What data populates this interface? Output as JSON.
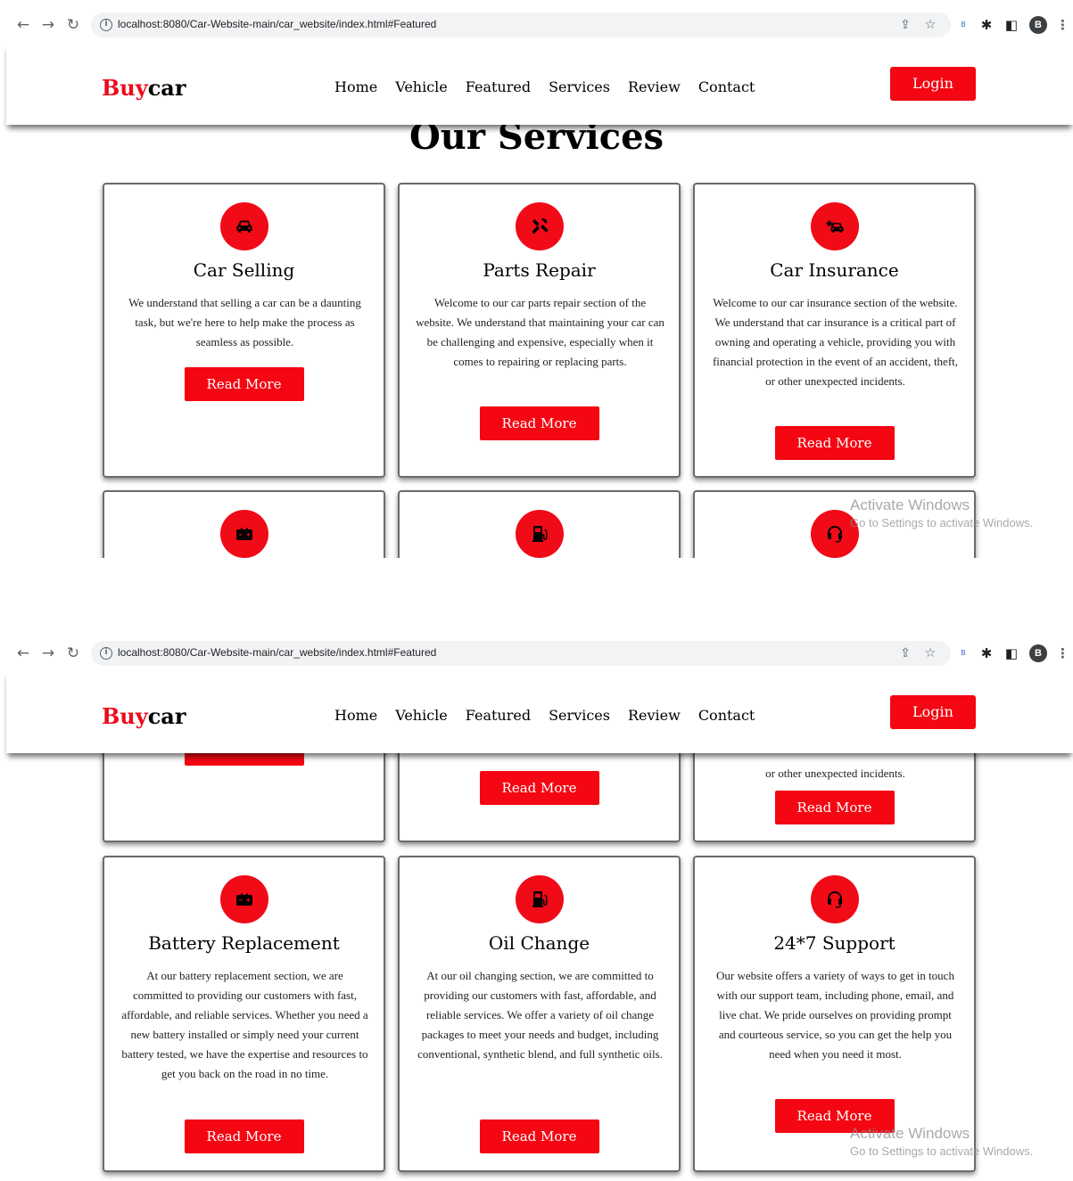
{
  "browser": {
    "url_host": "localhost",
    "url_path": ":8080/Car-Website-main/car_website/index.html#Featured",
    "avatar_letter": "B",
    "profile_badge": "B"
  },
  "header": {
    "logo_red": "Buy",
    "logo_dark": "car",
    "nav": [
      "Home",
      "Vehicle",
      "Featured",
      "Services",
      "Review",
      "Contact"
    ],
    "login_label": "Login"
  },
  "services": {
    "title": "Our Services",
    "cards": [
      {
        "icon": "car-icon",
        "title": "Car Selling",
        "text": "We understand that selling a car can be a daunting task, but we're here to help make the process as seamless as possible.",
        "button": "Read More"
      },
      {
        "icon": "tools-icon",
        "title": "Parts Repair",
        "text": "Welcome to our car parts repair section of the website. We understand that maintaining your car can be challenging and expensive, especially when it comes to repairing or replacing parts.",
        "button": "Read More"
      },
      {
        "icon": "car-crash-icon",
        "title": "Car Insurance",
        "text": "Welcome to our car insurance section of the website. We understand that car insurance is a critical part of owning and operating a vehicle, providing you with financial protection in the event of an accident, theft, or other unexpected incidents.",
        "button": "Read More"
      },
      {
        "icon": "battery-icon",
        "title": "Battery Replacement",
        "text": "At our battery replacement section, we are committed to providing our customers with fast, affordable, and reliable services. Whether you need a new battery installed or simply need your current battery tested, we have the expertise and resources to get you back on the road in no time.",
        "button": "Read More"
      },
      {
        "icon": "fuel-pump-icon",
        "title": "Oil Change",
        "text": "At our oil changing section, we are committed to providing our customers with fast, affordable, and reliable services. We offer a variety of oil change packages to meet your needs and budget, including conventional, synthetic blend, and full synthetic oils.",
        "button": "Read More"
      },
      {
        "icon": "headset-icon",
        "title": "24*7 Support",
        "text": "Our website offers a variety of ways to get in touch with our support team, including phone, email, and live chat. We pride ourselves on providing prompt and courteous service, so you can get the help you need when you need it most.",
        "button": "Read More"
      }
    ]
  },
  "watermark": {
    "title": "Activate Windows",
    "subtitle": "Go to Settings to activate Windows."
  },
  "colors": {
    "accent": "#f40612",
    "logo_red": "#ee0a1c"
  }
}
